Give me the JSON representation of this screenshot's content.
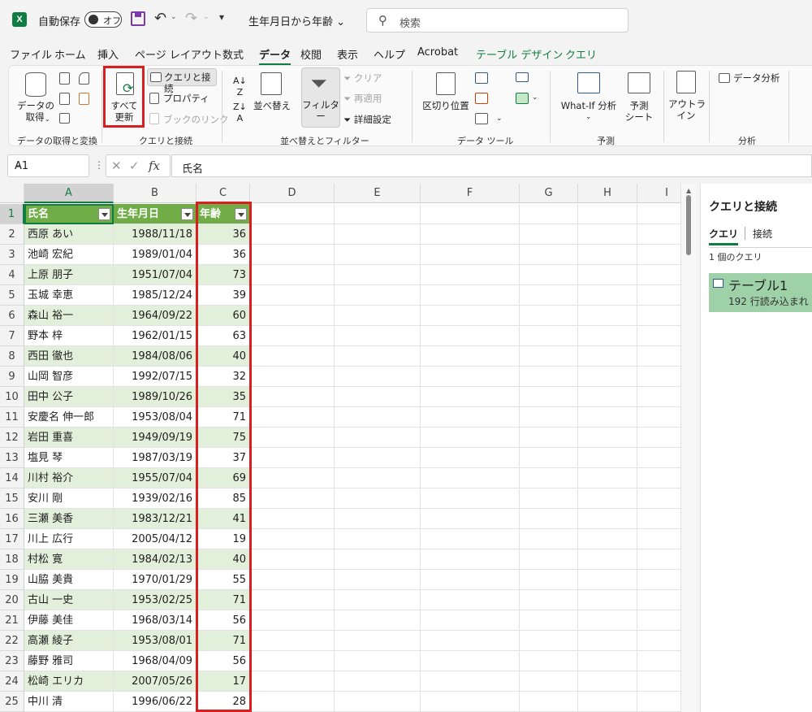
{
  "titlebar": {
    "app_icon": "X",
    "autosave_label": "自動保存",
    "autosave_state": "オフ",
    "doc_title": "生年月日から年齢",
    "doc_title_chevron": "⌄",
    "search_placeholder": "検索"
  },
  "tabs": [
    "ファイル",
    "ホーム",
    "挿入",
    "ページ レイアウト",
    "数式",
    "データ",
    "校閲",
    "表示",
    "ヘルプ",
    "Acrobat",
    "テーブル デザイン",
    "クエリ"
  ],
  "active_tab": "データ",
  "ribbon": {
    "get_data": "データの\n取得",
    "refresh_all": "すべて\n更新",
    "queries_connections": "クエリと接続",
    "properties": "プロパティ",
    "book_links": "ブックのリンク",
    "sort": "並べ替え",
    "filter": "フィルター",
    "clear": "クリア",
    "reapply": "再適用",
    "advanced": "詳細設定",
    "text_to_columns": "区切り位置",
    "what_if": "What-If 分析",
    "forecast_sheet": "予測\nシート",
    "outline": "アウトラ\nイン",
    "data_analysis": "データ分析",
    "groups": {
      "get_transform": "データの取得と変換",
      "queries": "クエリと接続",
      "sort_filter": "並べ替えとフィルター",
      "data_tools": "データ ツール",
      "forecast": "予測",
      "analysis": "分析"
    }
  },
  "formula_bar": {
    "name_box": "A1",
    "formula": "氏名"
  },
  "columns": [
    "A",
    "B",
    "C",
    "D",
    "E",
    "F",
    "G",
    "H",
    "I"
  ],
  "table": {
    "headers": [
      "氏名",
      "生年月日",
      "年齢"
    ],
    "rows": [
      [
        "西原 あい",
        "1988/11/18",
        "36"
      ],
      [
        "池崎 宏紀",
        "1989/01/04",
        "36"
      ],
      [
        "上原 朋子",
        "1951/07/04",
        "73"
      ],
      [
        "玉城 幸恵",
        "1985/12/24",
        "39"
      ],
      [
        "森山 裕一",
        "1964/09/22",
        "60"
      ],
      [
        "野本 梓",
        "1962/01/15",
        "63"
      ],
      [
        "西田 徹也",
        "1984/08/06",
        "40"
      ],
      [
        "山岡 智彦",
        "1992/07/15",
        "32"
      ],
      [
        "田中 公子",
        "1989/10/26",
        "35"
      ],
      [
        "安慶名 伸一郎",
        "1953/08/04",
        "71"
      ],
      [
        "岩田 重喜",
        "1949/09/19",
        "75"
      ],
      [
        "塩見 琴",
        "1987/03/19",
        "37"
      ],
      [
        "川村 裕介",
        "1955/07/04",
        "69"
      ],
      [
        "安川 剛",
        "1939/02/16",
        "85"
      ],
      [
        "三瀬 美香",
        "1983/12/21",
        "41"
      ],
      [
        "川上 広行",
        "2005/04/12",
        "19"
      ],
      [
        "村松 寛",
        "1984/02/13",
        "40"
      ],
      [
        "山脇 美貴",
        "1970/01/29",
        "55"
      ],
      [
        "古山 一史",
        "1953/02/25",
        "71"
      ],
      [
        "伊藤 美佳",
        "1968/03/14",
        "56"
      ],
      [
        "高瀬 綾子",
        "1953/08/01",
        "71"
      ],
      [
        "藤野 雅司",
        "1968/04/09",
        "56"
      ],
      [
        "松崎 エリカ",
        "2007/05/26",
        "17"
      ],
      [
        "中川 清",
        "1996/06/22",
        "28"
      ]
    ]
  },
  "side_pane": {
    "title": "クエリと接続",
    "tab_queries": "クエリ",
    "tab_connections": "接続",
    "count": "1 個のクエリ",
    "query_name": "テーブル1",
    "query_info": "192 行読み込まれ"
  },
  "colors": {
    "accent": "#107c41",
    "table_header": "#70ad47",
    "table_band": "#e2efda",
    "highlight": "#d81e1e"
  }
}
